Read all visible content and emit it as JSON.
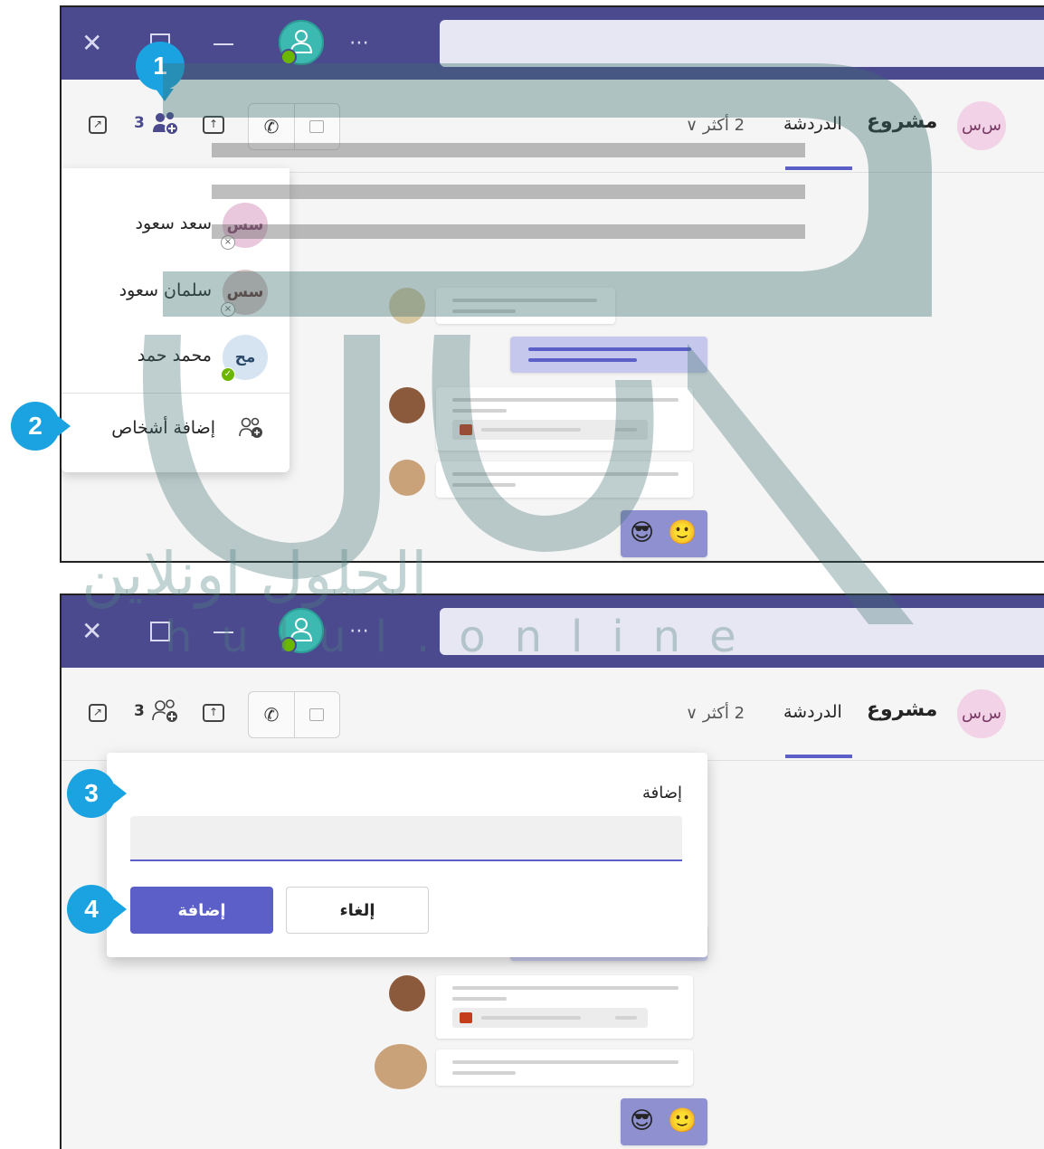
{
  "screen1": {
    "titlebar": {
      "more_label": "⋯"
    },
    "header": {
      "people_count": "3",
      "call_audio_icon": "phone-icon",
      "more_label": "2 أكثر ∨",
      "tab_label": "الدردشة",
      "title": "مشروع",
      "avatar_initials": "س‌س"
    },
    "dropdown": {
      "items": [
        {
          "name": "سعد سعود",
          "initials": "سس",
          "status": "offline"
        },
        {
          "name": "سلمان سعود",
          "initials": "سس",
          "status": "offline"
        },
        {
          "name": "محمد حمد",
          "initials": "مح",
          "status": "available"
        }
      ],
      "add_label": "إضافة أشخاص"
    },
    "callouts": [
      "1",
      "2"
    ]
  },
  "screen2": {
    "header": {
      "people_count": "3",
      "more_label": "2 أكثر ∨",
      "tab_label": "الدردشة",
      "title": "مشروع",
      "avatar_initials": "س‌س"
    },
    "dialog": {
      "label": "إضافة",
      "input_value": "",
      "add_button": "إضافة",
      "cancel_button": "إلغاء"
    },
    "callouts": [
      "3",
      "4"
    ]
  },
  "watermark": {
    "arabic": "الحلول اونلاين",
    "latin": "hulul.online"
  },
  "colors": {
    "titlebar": "#4b4a8f",
    "accent": "#5b5fc7",
    "callout": "#1aa3e0",
    "available": "#6bb700"
  }
}
